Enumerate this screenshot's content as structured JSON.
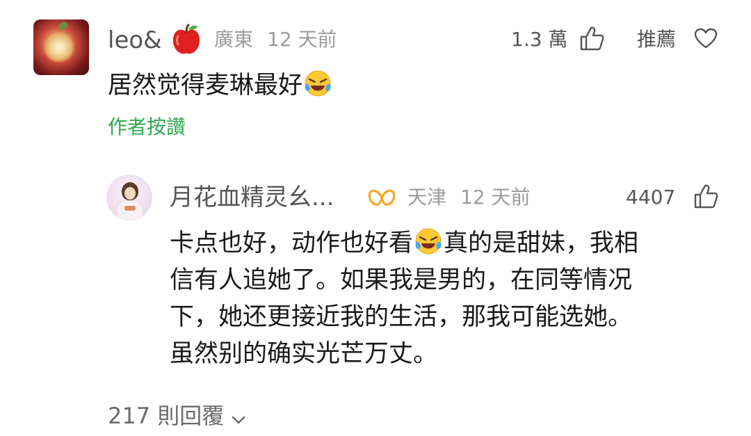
{
  "comment": {
    "username": "leo&",
    "username_icon": "red-apple-icon",
    "location": "廣東",
    "time": "12 天前",
    "likes": "1.3 萬",
    "recommend_label": "推薦",
    "text": "居然觉得麦琳最好",
    "text_emoji": "laughing-crying-emoji",
    "author_liked": "作者按讚"
  },
  "reply": {
    "username": "月花血精灵幺...",
    "username_badge": "infinity-badge-icon",
    "location": "天津",
    "time": "12 天前",
    "likes": "4407",
    "lines": [
      "卡点也好，动作也好看",
      "真的是甜妹，我相",
      "信有人追她了。如果我是男的，在同等情况",
      "下，她还更接近我的生活，那我可能选她。",
      "虽然别的确实光芒万丈。"
    ],
    "text_emoji": "laughing-crying-emoji"
  },
  "thread": {
    "reply_count": "217 則回覆"
  },
  "colors": {
    "author_liked": "#2fa84f",
    "badge": "#f5a623",
    "meta": "#9b9b9b"
  }
}
